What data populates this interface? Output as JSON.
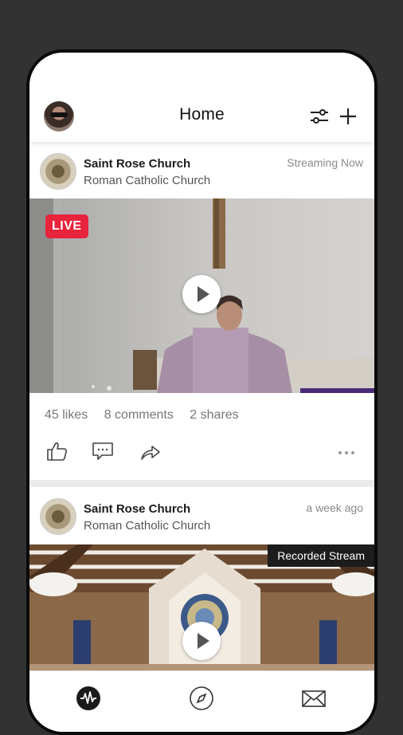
{
  "header": {
    "title": "Home"
  },
  "posts": [
    {
      "name": "Saint Rose Church",
      "subtitle": "Roman Catholic Church",
      "time": "Streaming Now",
      "badge": "LIVE",
      "likes": "45 likes",
      "comments": "8 comments",
      "shares": "2 shares"
    },
    {
      "name": "Saint Rose Church",
      "subtitle": "Roman Catholic Church",
      "time": "a week ago",
      "badge": "Recorded Stream"
    }
  ],
  "icons": {
    "header": [
      "profile-avatar",
      "filter-sliders-icon",
      "plus-icon"
    ],
    "actions": [
      "like-icon",
      "comment-icon",
      "share-icon",
      "more-icon"
    ],
    "nav": [
      "feed-icon",
      "compass-icon",
      "mail-icon"
    ]
  },
  "colors": {
    "live": "#e8233c",
    "accent_purple": "#5a2c8a"
  }
}
